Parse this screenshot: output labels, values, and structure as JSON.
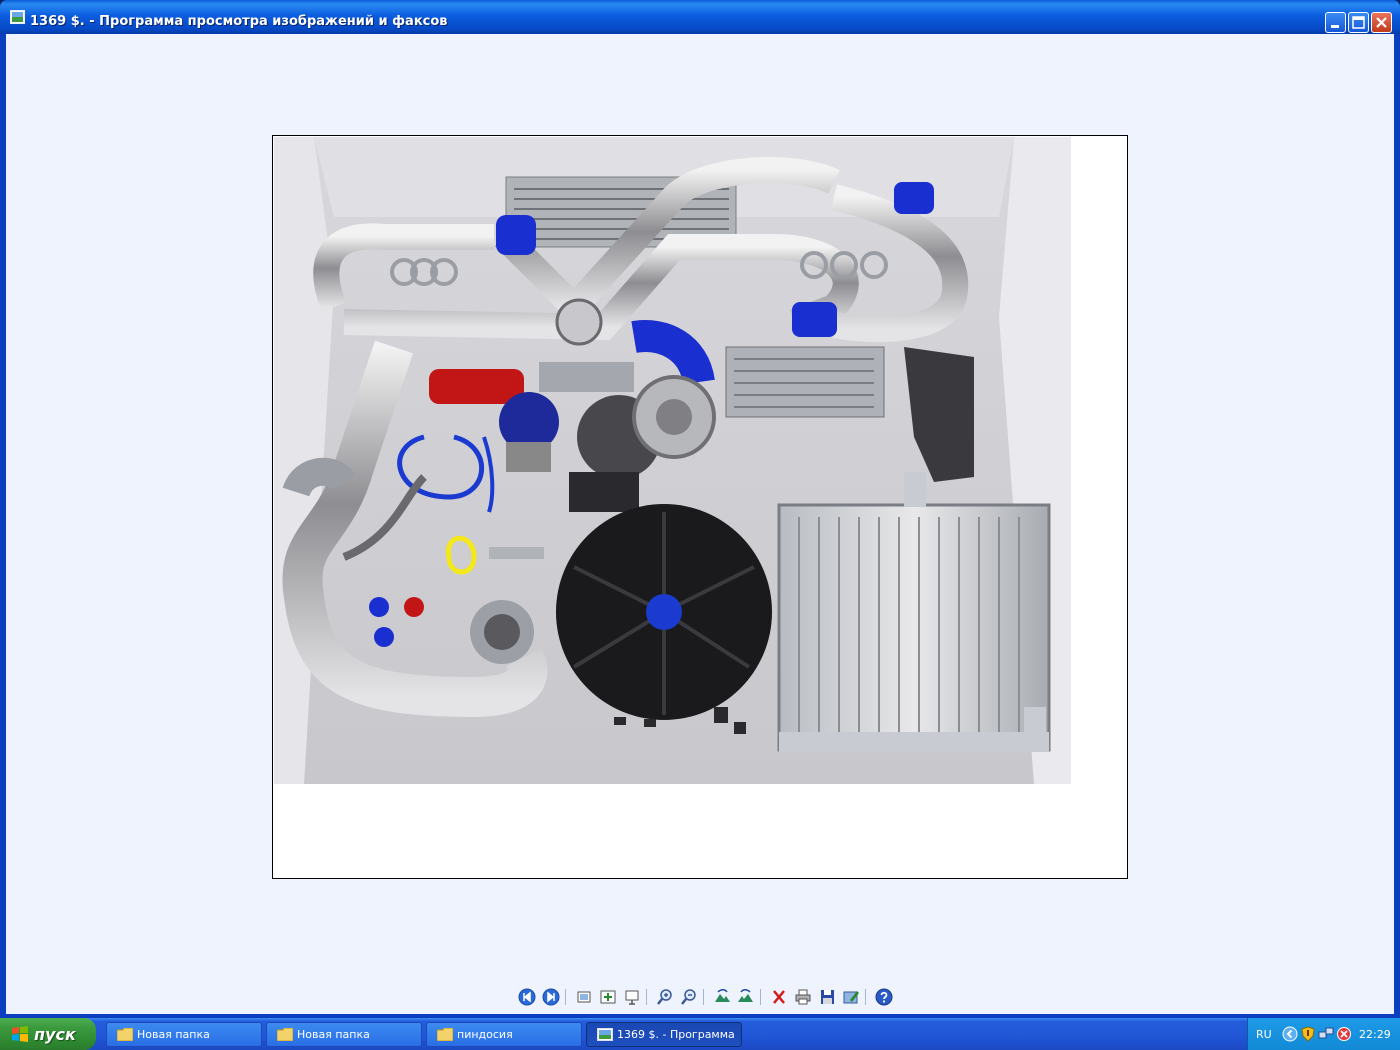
{
  "window": {
    "title": "1369 $. - Программа просмотра изображений и факсов"
  },
  "viewer": {
    "image_alt": "turbo kit components photo"
  },
  "toolbar": {
    "buttons": [
      {
        "name": "previous-image-button",
        "icon": "previous-icon"
      },
      {
        "name": "next-image-button",
        "icon": "next-icon"
      },
      {
        "name": "best-fit-button",
        "icon": "best-fit-icon"
      },
      {
        "name": "actual-size-button",
        "icon": "actual-size-icon"
      },
      {
        "name": "slideshow-button",
        "icon": "slideshow-icon"
      },
      {
        "name": "zoom-in-button",
        "icon": "zoom-in-icon"
      },
      {
        "name": "zoom-out-button",
        "icon": "zoom-out-icon"
      },
      {
        "name": "rotate-clockwise-button",
        "icon": "rotate-cw-icon"
      },
      {
        "name": "rotate-counterclockwise-button",
        "icon": "rotate-ccw-icon"
      },
      {
        "name": "delete-button",
        "icon": "delete-icon"
      },
      {
        "name": "print-button",
        "icon": "print-icon"
      },
      {
        "name": "save-button",
        "icon": "save-icon"
      },
      {
        "name": "edit-button",
        "icon": "edit-icon"
      },
      {
        "name": "help-button",
        "icon": "help-icon"
      }
    ]
  },
  "taskbar": {
    "start_label": "пуск",
    "tasks": [
      {
        "label": "Новая папка",
        "icon": "folder-icon",
        "active": false
      },
      {
        "label": "Новая папка",
        "icon": "folder-icon",
        "active": false
      },
      {
        "label": "пиндосия",
        "icon": "folder-icon",
        "active": false
      },
      {
        "label": "1369 $. - Программа ...",
        "icon": "image-viewer-icon",
        "active": true
      }
    ],
    "tray": {
      "language": "RU",
      "time": "22:29"
    }
  },
  "colors": {
    "titlebar": "#0c5ee0",
    "client_background": "#eff3fd",
    "taskbar": "#2157d6",
    "start_button": "#3c9a3e",
    "tray": "#128ad6"
  }
}
